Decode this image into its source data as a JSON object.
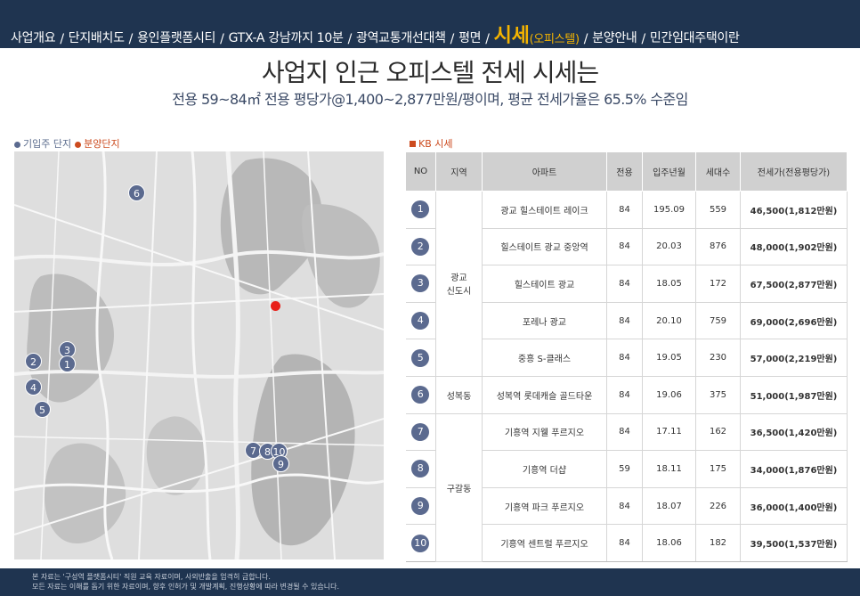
{
  "nav": {
    "items": [
      "사업개요",
      "단지배치도",
      "용인플랫폼시티",
      "GTX-A 강남까지 10분",
      "광역교통개선대책",
      "평면"
    ],
    "active": "시세",
    "active_sub": "(오피스텔)",
    "after": [
      "분양안내",
      "민간임대주택이란"
    ]
  },
  "headline": "사업지 인근 오피스텔 전세 시세는",
  "subline": "전용 59~84㎡ 전용 평당가@1,400~2,877만원/평이며, 평균 전세가율은 65.5% 수준임",
  "legend": {
    "existing": "기입주 단지",
    "sale": "분양단지"
  },
  "kb_label": "KB 시세",
  "table": {
    "headers": [
      "NO",
      "지역",
      "아파트",
      "전용",
      "입주년월",
      "세대수",
      "전세가(전용평당가)"
    ],
    "rows": [
      {
        "no": "1",
        "region": "광교\n신도시",
        "apt": "광교 힐스테이트 레이크",
        "area": "84",
        "date": "195.09",
        "units": "559",
        "price": "46,500(1,812만원)"
      },
      {
        "no": "2",
        "region": "",
        "apt": "힐스테이트 광교 중앙역",
        "area": "84",
        "date": "20.03",
        "units": "876",
        "price": "48,000(1,902만원)"
      },
      {
        "no": "3",
        "region": "",
        "apt": "힐스테이트 광교",
        "area": "84",
        "date": "18.05",
        "units": "172",
        "price": "67,500(2,877만원)"
      },
      {
        "no": "4",
        "region": "",
        "apt": "포레나 광교",
        "area": "84",
        "date": "20.10",
        "units": "759",
        "price": "69,000(2,696만원)"
      },
      {
        "no": "5",
        "region": "",
        "apt": "중흥 S-클래스",
        "area": "84",
        "date": "19.05",
        "units": "230",
        "price": "57,000(2,219만원)"
      },
      {
        "no": "6",
        "region": "성복동",
        "apt": "성복역 롯데캐슬 골드타운",
        "area": "84",
        "date": "19.06",
        "units": "375",
        "price": "51,000(1,987만원)"
      },
      {
        "no": "7",
        "region": "구갈동",
        "apt": "기흥역 지웰 푸르지오",
        "area": "84",
        "date": "17.11",
        "units": "162",
        "price": "36,500(1,420만원)"
      },
      {
        "no": "8",
        "region": "",
        "apt": "기흥역 더샵",
        "area": "59",
        "date": "18.11",
        "units": "175",
        "price": "34,000(1,876만원)"
      },
      {
        "no": "9",
        "region": "",
        "apt": "기흥역 파크 푸르지오",
        "area": "84",
        "date": "18.07",
        "units": "226",
        "price": "36,000(1,400만원)"
      },
      {
        "no": "10",
        "region": "",
        "apt": "기흥역 센트럴 푸르지오",
        "area": "84",
        "date": "18.06",
        "units": "182",
        "price": "39,500(1,537만원)"
      }
    ]
  },
  "map_pins": [
    "6",
    "3",
    "2",
    "1",
    "4",
    "5",
    "7",
    "8",
    "10",
    "9"
  ],
  "footer": {
    "line1": "본 자료는 '구성역 플랫폼시티' 직원 교육 자료이며, 사외반출을 엄격히 금합니다.",
    "line2": "모든 자료는 이해를 돕기 위한 자료이며, 향후 인허가 및 개발계획, 진행상황에 따라 변경될 수 있습니다."
  },
  "colors": {
    "navy": "#1f3450",
    "accent": "#f4b400",
    "pin": "#5b6a8f",
    "price": "#b52a12"
  }
}
